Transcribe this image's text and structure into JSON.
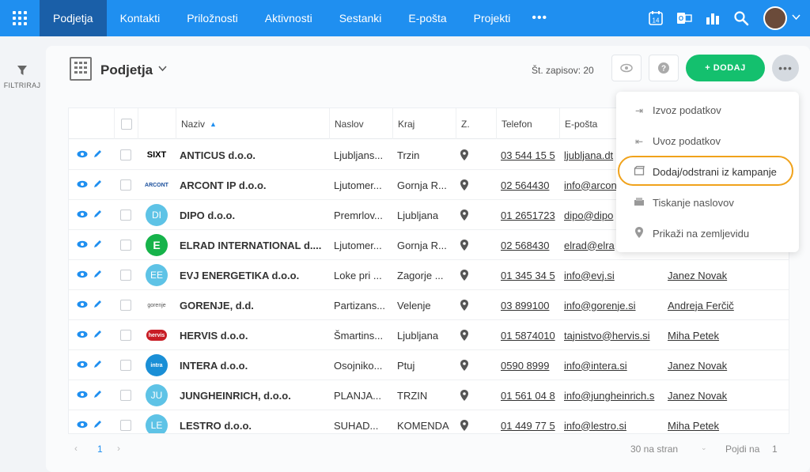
{
  "nav": {
    "items": [
      "Podjetja",
      "Kontakti",
      "Priložnosti",
      "Aktivnosti",
      "Sestanki",
      "E-pošta",
      "Projekti"
    ],
    "more": "•••",
    "calendar_day": "14"
  },
  "left": {
    "filter_label": "FILTRIRAJ"
  },
  "header": {
    "title": "Podjetja",
    "record_count": "Št. zapisov: 20",
    "add_label": "+ DODAJ"
  },
  "table": {
    "columns": [
      "Naziv",
      "Naslov",
      "Kraj",
      "Z.",
      "Telefon",
      "E-pošta"
    ],
    "rows": [
      {
        "name": "ANTICUS d.o.o.",
        "address": "Ljubljans...",
        "city": "Trzin",
        "phone": "03 544 15 5",
        "email": "ljubljana.dt",
        "contact": ""
      },
      {
        "name": "ARCONT IP d.o.o.",
        "address": "Ljutomer...",
        "city": "Gornja R...",
        "phone": "02 564430",
        "email": "info@arcon",
        "contact": ""
      },
      {
        "name": "DIPO d.o.o.",
        "address": "Premrlov...",
        "city": "Ljubljana",
        "phone": "01 2651723",
        "email": "dipo@dipo",
        "contact": ""
      },
      {
        "name": "ELRAD INTERNATIONAL d....",
        "address": "Ljutomer...",
        "city": "Gornja R...",
        "phone": "02 568430",
        "email": "elrad@elra",
        "contact": ""
      },
      {
        "name": "EVJ ENERGETIKA d.o.o.",
        "address": "Loke pri ...",
        "city": "Zagorje ...",
        "phone": "01 345 34 5",
        "email": "info@evj.si",
        "contact": "Janez Novak"
      },
      {
        "name": "GORENJE, d.d.",
        "address": "Partizans...",
        "city": "Velenje",
        "phone": "03 899100",
        "email": "info@gorenje.si",
        "contact": "Andreja Ferčič"
      },
      {
        "name": "HERVIS d.o.o.",
        "address": "Šmartins...",
        "city": "Ljubljana",
        "phone": "01 5874010",
        "email": "tajnistvo@hervis.si",
        "contact": "Miha Petek"
      },
      {
        "name": "INTERA d.o.o.",
        "address": "Osojniko...",
        "city": "Ptuj",
        "phone": "0590 8999",
        "email": "info@intera.si",
        "contact": "Janez Novak"
      },
      {
        "name": "JUNGHEINRICH, d.o.o.",
        "address": "PLANJA...",
        "city": "TRZIN",
        "phone": "01 561 04 8",
        "email": "info@jungheinrich.s",
        "contact": "Janez Novak"
      },
      {
        "name": "LESTRO d.o.o.",
        "address": "SUHAD...",
        "city": "KOMENDA",
        "phone": "01 449 77 5",
        "email": "info@lestro.si",
        "contact": "Miha Petek"
      }
    ],
    "logos": [
      "SIXT",
      "ARCONT",
      "DI",
      "E",
      "EE",
      "gorenje",
      "hervis",
      "intra",
      "JU",
      "LE"
    ]
  },
  "pager": {
    "page": "1",
    "per_page": "30 na stran",
    "goto_label": "Pojdi na",
    "goto_value": "1"
  },
  "dropdown": {
    "items": [
      "Izvoz podatkov",
      "Uvoz podatkov",
      "Dodaj/odstrani iz kampanje",
      "Tiskanje naslovov",
      "Prikaži na zemljevidu"
    ]
  },
  "colors": {
    "nav": "#1f8ff0",
    "nav_active": "#1a5fa8",
    "accent": "#14c06e",
    "highlight": "#f0a21b"
  }
}
